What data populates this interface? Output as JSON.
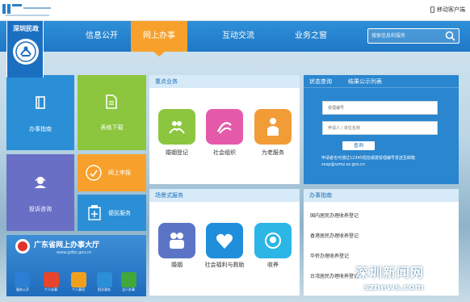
{
  "topbar": {
    "mobile_label": "移动客户端"
  },
  "brand": {
    "name": "深圳民政"
  },
  "nav": {
    "items": [
      {
        "label": "信息公开"
      },
      {
        "label": "网上办事"
      },
      {
        "label": "互动交流"
      },
      {
        "label": "业务之窗"
      }
    ],
    "active": "网上办事"
  },
  "search": {
    "placeholder": "搜索信息和服务"
  },
  "tiles": {
    "guide": "办事指南",
    "forms": "表格下载",
    "consult": "投诉咨询",
    "online_apply": "网上申报",
    "service": "便民服务"
  },
  "key_services": {
    "header": "重点业务",
    "apps": [
      {
        "label": "婚姻登记",
        "icon": "marriage-icon"
      },
      {
        "label": "社会组织",
        "icon": "social-org-icon"
      },
      {
        "label": "为老服务",
        "icon": "elderly-icon"
      }
    ]
  },
  "scene_services": {
    "header": "场景式服务",
    "apps": [
      {
        "label": "婚姻",
        "icon": "couple-icon"
      },
      {
        "label": "社会福利与救助",
        "icon": "heart-icon"
      },
      {
        "label": "收养",
        "icon": "baby-icon"
      }
    ]
  },
  "status": {
    "tabs": [
      "状态查询",
      "结果公示列表"
    ],
    "field1_placeholder": "受理编号",
    "field2_placeholder": "申请人 / 单位名称",
    "query_label": "查询",
    "note": "申请者也可通过12345短信或拨受理编号发送至邮箱 zxsp@szmz.sz.gov.cn"
  },
  "guide_list": {
    "header": "办事指南",
    "items": [
      "国内居民办理收养登记",
      "香港居民办理收养登记",
      "华侨办理收养登记",
      "台湾居民办理收养登记"
    ]
  },
  "guangdong": {
    "title": "广东省网上办事大厅",
    "url": "www.gdbs.gov.cn",
    "buttons": [
      "服务公开",
      "个人办事",
      "个人事项",
      "阳光政务",
      "法人办事"
    ]
  },
  "watermark": {
    "cn": "深圳新闻网",
    "en": "sznews.com"
  },
  "colors": {
    "nav": "#2080cc",
    "active": "#f7a12c",
    "tile_blue": "#2a8fd6",
    "tile_green": "#8cc63f",
    "tile_orange": "#f7a12c",
    "tile_purple": "#6a6fc6"
  }
}
